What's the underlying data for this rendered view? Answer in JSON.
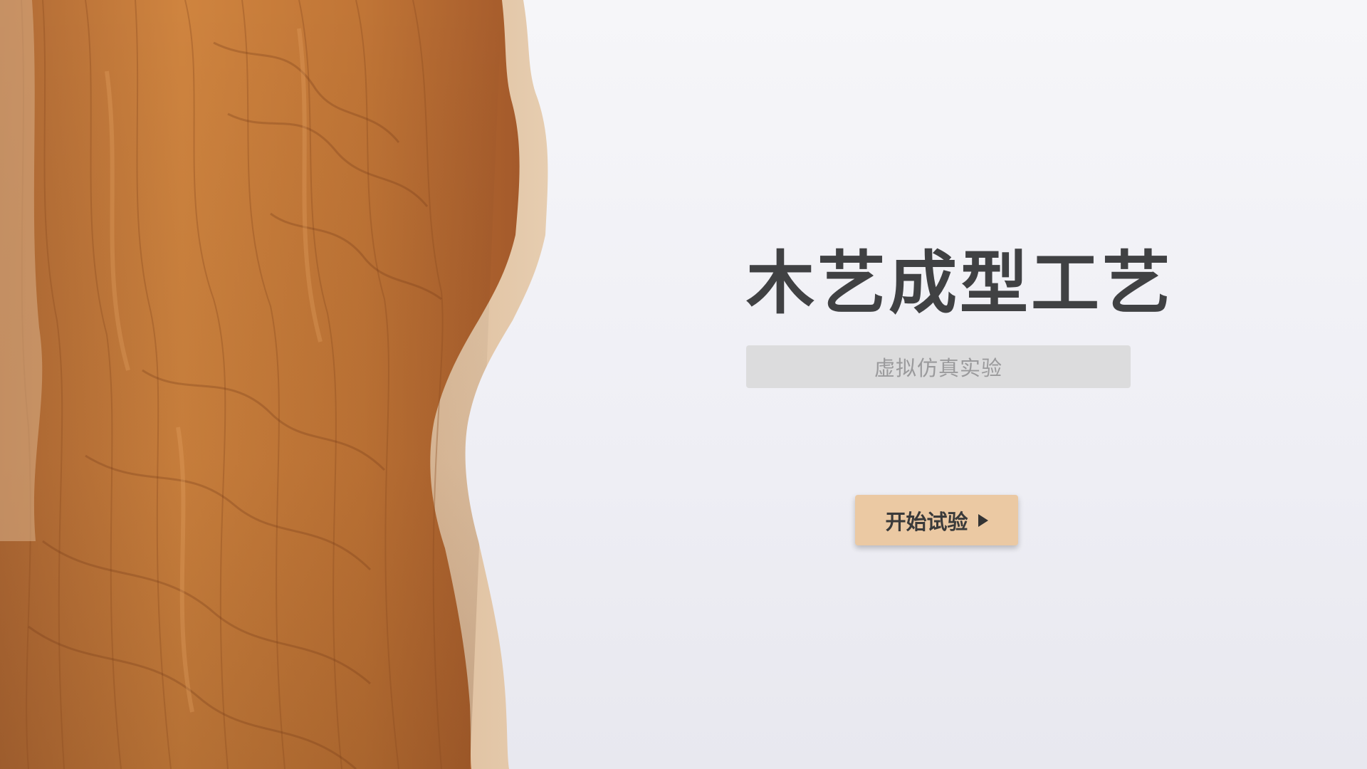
{
  "app": {
    "title": "木艺成型工艺",
    "subtitle": "虚拟仿真实验"
  },
  "start_button": {
    "label": "开始试验",
    "icon": "play-icon"
  },
  "background": {
    "image": "wood-slab-grain",
    "colors": {
      "page": "#f2f2f7",
      "wood_base": "#c57a3a",
      "wood_dark": "#8e4a20",
      "wood_edge": "#d9b48c",
      "title": "#404143",
      "subtitle_bar": "#dcdcdd",
      "subtitle_text": "#9a9a9c",
      "button": "#ebc9a3"
    }
  }
}
